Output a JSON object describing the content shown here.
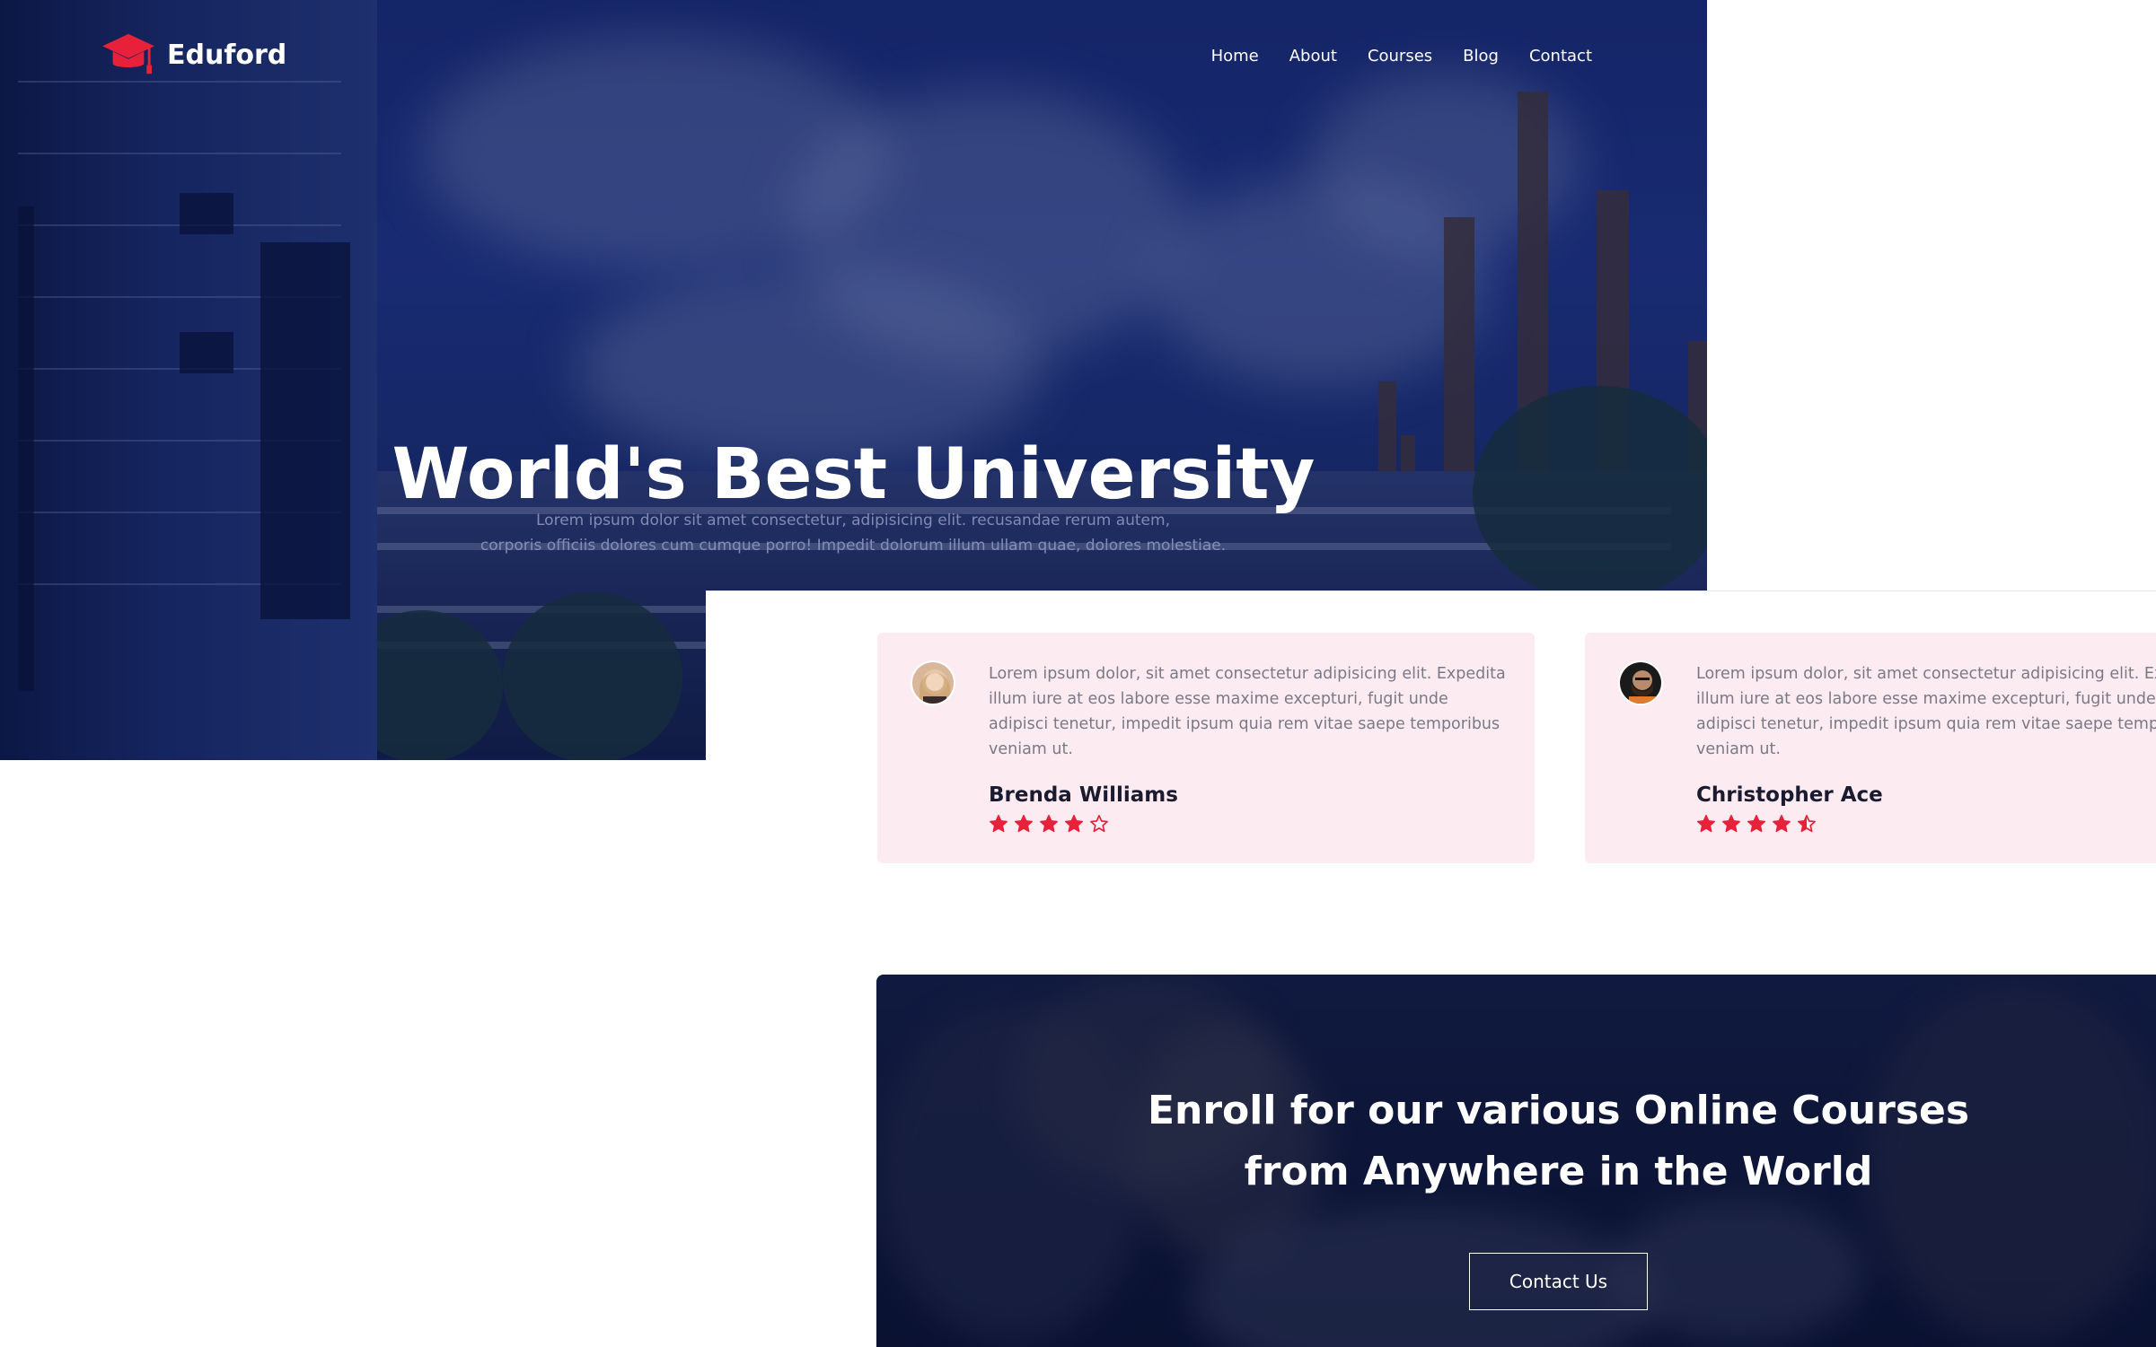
{
  "brand": {
    "name": "Eduford",
    "logo_icon": "graduation-cap-icon",
    "accent_color": "#e8213a"
  },
  "nav": {
    "items": [
      "Home",
      "About",
      "Courses",
      "Blog",
      "Contact"
    ]
  },
  "hero": {
    "title": "World's Best University",
    "description_line1": "Lorem ipsum dolor sit amet consectetur, adipisicing elit. recusandae rerum autem,",
    "description_line2": "corporis officiis dolores cum cumque porro! Impedit dolorum illum ullam quae, dolores molestiae."
  },
  "testimonials": [
    {
      "quote": "Lorem ipsum dolor, sit amet consectetur adipisicing elit. Expedita illum iure at eos labore esse maxime excepturi, fugit unde adipisci tenetur, impedit ipsum quia rem vitae saepe temporibus veniam ut.",
      "name": "Brenda Williams",
      "rating": 4
    },
    {
      "quote": "Lorem ipsum dolor, sit amet consectetur adipisicing elit. Expedita illum iure at eos labore esse maxime excepturi, fugit unde adipisci tenetur, impedit ipsum quia rem vitae saepe temporibus veniam ut.",
      "name": "Christopher Ace",
      "rating": 4.5
    }
  ],
  "enroll": {
    "title_line1": "Enroll for our various Online Courses",
    "title_line2": "from Anywhere in the World",
    "button_label": "Contact Us"
  },
  "colors": {
    "star": "#e8213a",
    "card_bg": "#fdebf2",
    "hero_overlay": "#1e3278"
  }
}
